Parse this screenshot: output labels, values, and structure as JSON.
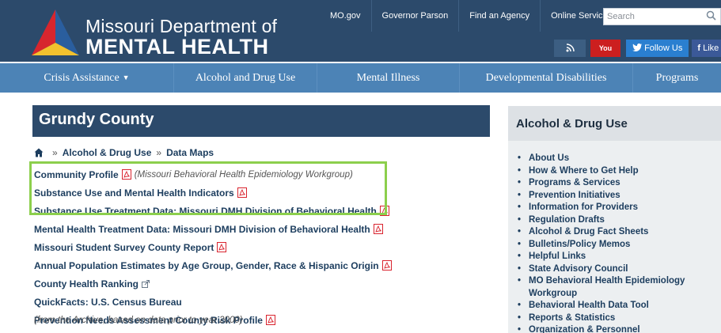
{
  "header": {
    "logo_line1": "Missouri Department of",
    "logo_line2": "MENTAL HEALTH",
    "topnav": [
      "MO.gov",
      "Governor Parson",
      "Find an Agency",
      "Online Services"
    ],
    "search_placeholder": "Search",
    "social": {
      "youtube": "You Tube",
      "follow": "Follow Us",
      "like": "Like U"
    }
  },
  "mainnav": {
    "items": [
      "Crisis Assistance",
      "Alcohol and Drug Use",
      "Mental Illness",
      "Developmental Disabilities",
      "Programs"
    ]
  },
  "page": {
    "title": "Grundy County",
    "breadcrumb": [
      "Alcohol & Drug Use",
      "Data Maps"
    ],
    "breadcrumb_sep": "»",
    "links": [
      {
        "text": "Community Profile",
        "pdf": true,
        "note": "(Missouri Behavioral Health Epidemiology Workgroup)"
      },
      {
        "text": "Substance Use and Mental Health Indicators",
        "pdf": true
      },
      {
        "text": "Substance Use Treatment Data: Missouri DMH Division of Behavioral Health",
        "pdf": true
      },
      {
        "text": "Mental Health Treatment Data: Missouri DMH Division of Behavioral Health",
        "pdf": true
      },
      {
        "text": "Missouri Student Survey County Report",
        "pdf": true
      },
      {
        "text": "Annual Population Estimates by Age Group, Gender, Race & Hispanic Origin",
        "pdf": true
      },
      {
        "text": "County Health Ranking",
        "external": true
      },
      {
        "text": "QuickFacts: U.S. Census Bureau"
      },
      {
        "text": "Prevention Needs Assessment County Risk Profile",
        "pdf": true
      }
    ],
    "archive_note": "(from the Archive, based on data prior to year 2000)"
  },
  "sidebar": {
    "title": "Alcohol & Drug Use",
    "items": [
      "About Us",
      "How & Where to Get Help",
      "Programs & Services",
      "Prevention Initiatives",
      "Information for Providers",
      "Regulation Drafts",
      "Alcohol & Drug Fact Sheets",
      "Bulletins/Policy Memos",
      "Helpful Links",
      "State Advisory Council",
      "MO Behavioral Health Epidemiology",
      "Workgroup",
      "Behavioral Health Data Tool",
      "Reports & Statistics",
      "Organization & Personnel"
    ]
  },
  "colors": {
    "header_bg": "#2c4a6b",
    "nav_bg": "#4c83b6",
    "highlight": "#8ccf4c",
    "link": "#1c3d5e",
    "pdf_red": "#d9232e"
  }
}
